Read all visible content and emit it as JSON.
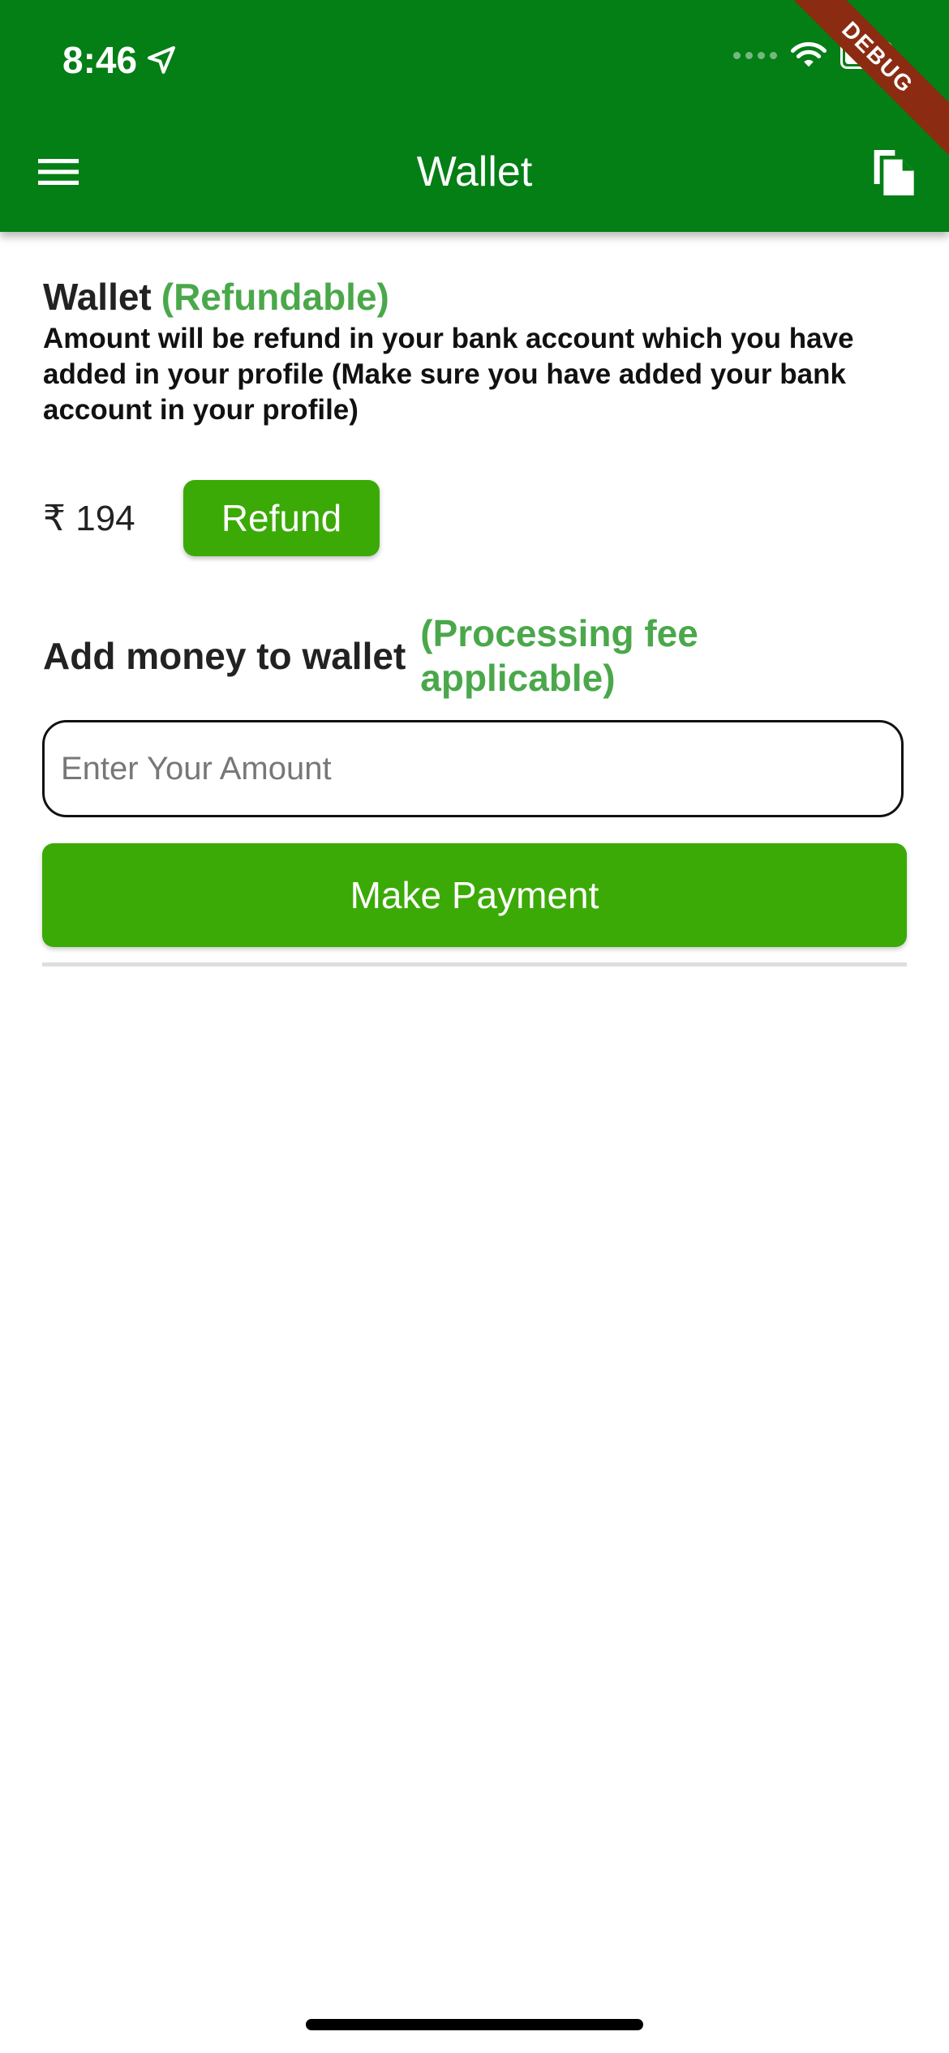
{
  "status_bar": {
    "time": "8:46"
  },
  "app_bar": {
    "title": "Wallet"
  },
  "debug_banner": "DEBUG",
  "wallet": {
    "heading": "Wallet",
    "refundable_tag": "(Refundable)",
    "description": "Amount will be refund in your bank account which you have added in your profile (Make sure you have added your bank account in your profile)",
    "balance": "₹ 194",
    "refund_label": "Refund"
  },
  "add_money": {
    "label": "Add money to wallet",
    "fee_note": "(Processing fee applicable)",
    "amount_placeholder": "Enter Your Amount",
    "amount_value": "",
    "pay_label": "Make Payment"
  },
  "colors": {
    "app_bar": "#037f15",
    "accent_button": "#3baa06",
    "accent_text": "#4aa84b",
    "debug_ribbon": "#8b2c12"
  },
  "icons": {
    "menu": "menu-icon",
    "copy": "copy-icon",
    "location": "location-arrow-icon",
    "wifi": "wifi-icon",
    "battery": "battery-icon"
  }
}
